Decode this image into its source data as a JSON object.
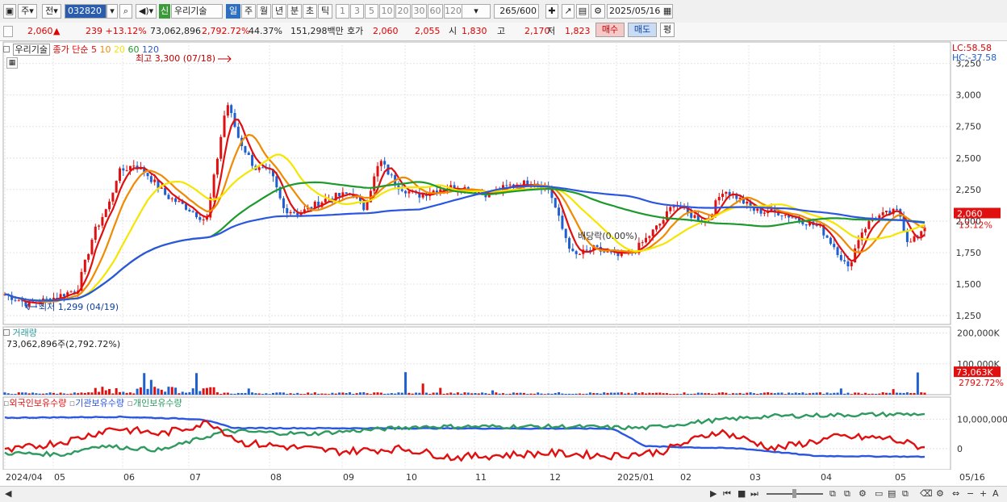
{
  "toolbar": {
    "unit_label": "주",
    "prev_label": "전",
    "stock_code": "032820",
    "new_badge": "신",
    "stock_name": "우리기술",
    "periods": [
      "일",
      "주",
      "월",
      "년",
      "분",
      "초",
      "틱"
    ],
    "active_period": "일",
    "intervals": [
      "1",
      "3",
      "5",
      "10",
      "20",
      "30",
      "60",
      "120"
    ],
    "count_value": "265",
    "count_total": "/600",
    "date_value": "2025/05/16"
  },
  "quote": {
    "price": "2,060",
    "change": "239 +13.12%",
    "volume": "73,062,896",
    "volume_pct": "2,792.72%",
    "turnover_pct": "44.37%",
    "amount": "151,298백만",
    "hoga_label": "호가",
    "bid": "2,060",
    "ask": "2,055",
    "open_label": "시",
    "open": "1,830",
    "high_label": "고",
    "high": "2,170",
    "low_label": "저",
    "low": "1,823",
    "buy_label": "매수",
    "sell_label": "매도",
    "flat_label": "평"
  },
  "price_panel": {
    "name_label": "우리기술",
    "ma_label": "종가 단순",
    "ma_periods": [
      "5",
      "10",
      "20",
      "60",
      "120"
    ],
    "high_note": "최고 3,300 (07/18)",
    "low_note": "최저 1,299 (04/19)",
    "dividend_note": "배당락(0.00%)",
    "lc_label": "LC:58.58",
    "hc_label": "HC:-37.58",
    "last_price_tag": "2,060",
    "last_pct_tag": "13.12%",
    "y_ticks": [
      "3,250",
      "3,000",
      "2,750",
      "2,500",
      "2,250",
      "2,000",
      "1,750",
      "1,500",
      "1,250"
    ]
  },
  "volume_panel": {
    "title": "거래량",
    "info": "73,062,896주(2,792.72%)",
    "y_ticks": [
      "200,000K",
      "100,000K"
    ],
    "last_vol_tag": "73,063K",
    "last_vol_pct": "2792.72%"
  },
  "holding_panel": {
    "series_names": [
      "외국인보유수량",
      "기관보유수량",
      "개인보유수량"
    ],
    "y_ticks": [
      "10,000,000",
      "0"
    ]
  },
  "x_axis": {
    "labels": [
      "2024/04",
      "05",
      "06",
      "07",
      "08",
      "09",
      "10",
      "11",
      "12",
      "2025/01",
      "02",
      "03",
      "04",
      "05",
      "05/16"
    ]
  },
  "colors": {
    "ma5": "#e01010",
    "ma10": "#f08a00",
    "ma20": "#f5e600",
    "ma60": "#1c9a2c",
    "ma120": "#2a56e0",
    "up": "#e01010",
    "down": "#1f5fd0",
    "foreign": "#e01010",
    "institution": "#2a56e0",
    "individual": "#2e9a60"
  }
}
